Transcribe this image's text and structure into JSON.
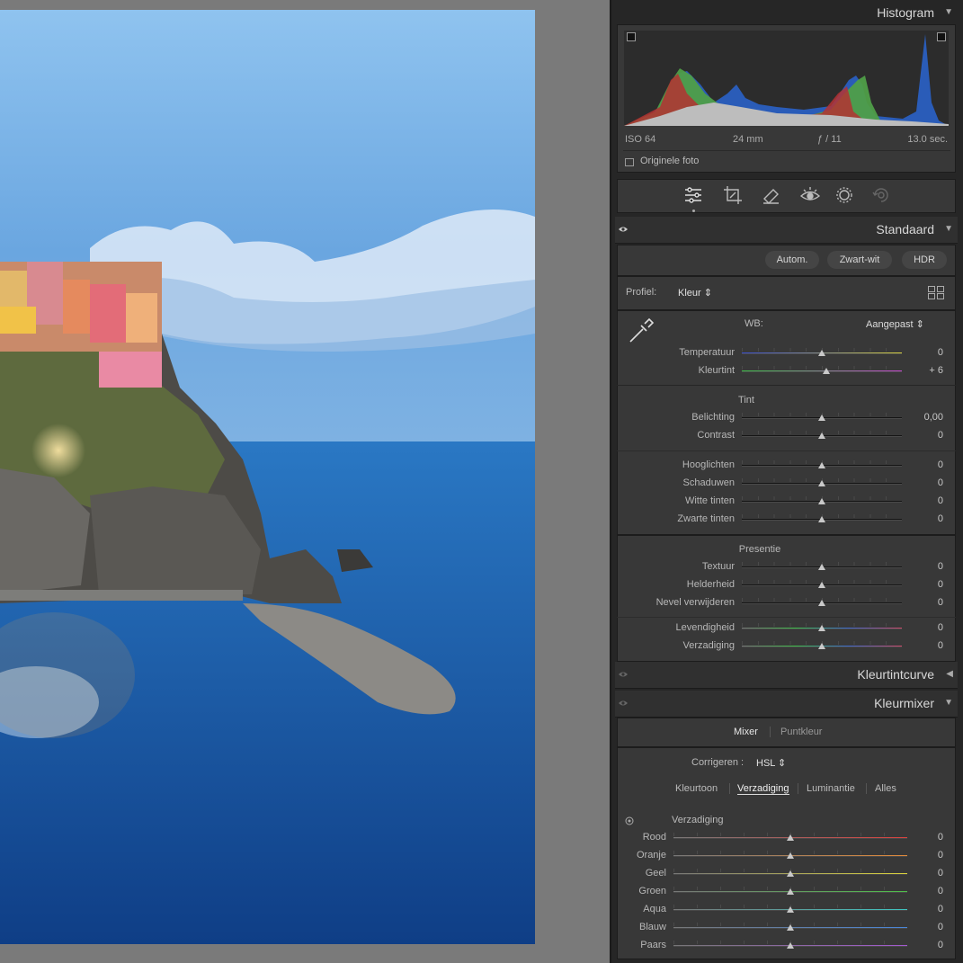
{
  "histogram": {
    "title": "Histogram",
    "iso": "ISO 64",
    "focal": "24 mm",
    "aperture": "ƒ / 11",
    "shutter": "13.0 sec.",
    "original_label": "Originele foto"
  },
  "tools": [
    "edit-sliders-icon",
    "crop-icon",
    "healing-icon",
    "redeye-icon",
    "masking-icon",
    "history-icon"
  ],
  "standaard": {
    "title": "Standaard",
    "buttons": {
      "auto": "Autom.",
      "bw": "Zwart-wit",
      "hdr": "HDR"
    },
    "profile_label": "Profiel:",
    "profile_value": "Kleur",
    "wb_label": "WB:",
    "wb_value": "Aangepast",
    "temp_label": "Temperatuur",
    "temp_value": "0",
    "temp_pos": 0.5,
    "tint_label": "Kleurtint",
    "tint_value": "+ 6",
    "tint_pos": 0.53,
    "tone_title": "Tint",
    "exposure_label": "Belichting",
    "exposure_value": "0,00",
    "contrast_label": "Contrast",
    "contrast_value": "0",
    "highlights_label": "Hooglichten",
    "highlights_value": "0",
    "shadows_label": "Schaduwen",
    "shadows_value": "0",
    "whites_label": "Witte tinten",
    "whites_value": "0",
    "blacks_label": "Zwarte tinten",
    "blacks_value": "0",
    "presence_title": "Presentie",
    "texture_label": "Textuur",
    "texture_value": "0",
    "clarity_label": "Helderheid",
    "clarity_value": "0",
    "dehaze_label": "Nevel verwijderen",
    "dehaze_value": "0",
    "vibrance_label": "Levendigheid",
    "vibrance_value": "0",
    "saturation_label": "Verzadiging",
    "saturation_value": "0"
  },
  "curve": {
    "title": "Kleurtintcurve"
  },
  "mixer": {
    "title": "Kleurmixer",
    "tab_mixer": "Mixer",
    "tab_point": "Puntkleur",
    "adjust_label": "Corrigeren :",
    "adjust_value": "HSL",
    "subtabs": {
      "hue": "Kleurtoon",
      "sat": "Verzadiging",
      "lum": "Luminantie",
      "all": "Alles"
    },
    "group_title": "Verzadiging",
    "rows": [
      {
        "label": "Rood",
        "value": "0",
        "color": "#d8433f"
      },
      {
        "label": "Oranje",
        "value": "0",
        "color": "#e0893a"
      },
      {
        "label": "Geel",
        "value": "0",
        "color": "#d8d03c"
      },
      {
        "label": "Groen",
        "value": "0",
        "color": "#4fbf4a"
      },
      {
        "label": "Aqua",
        "value": "0",
        "color": "#3fc4c0"
      },
      {
        "label": "Blauw",
        "value": "0",
        "color": "#4a86d8"
      },
      {
        "label": "Paars",
        "value": "0",
        "color": "#a35ad0"
      }
    ]
  }
}
